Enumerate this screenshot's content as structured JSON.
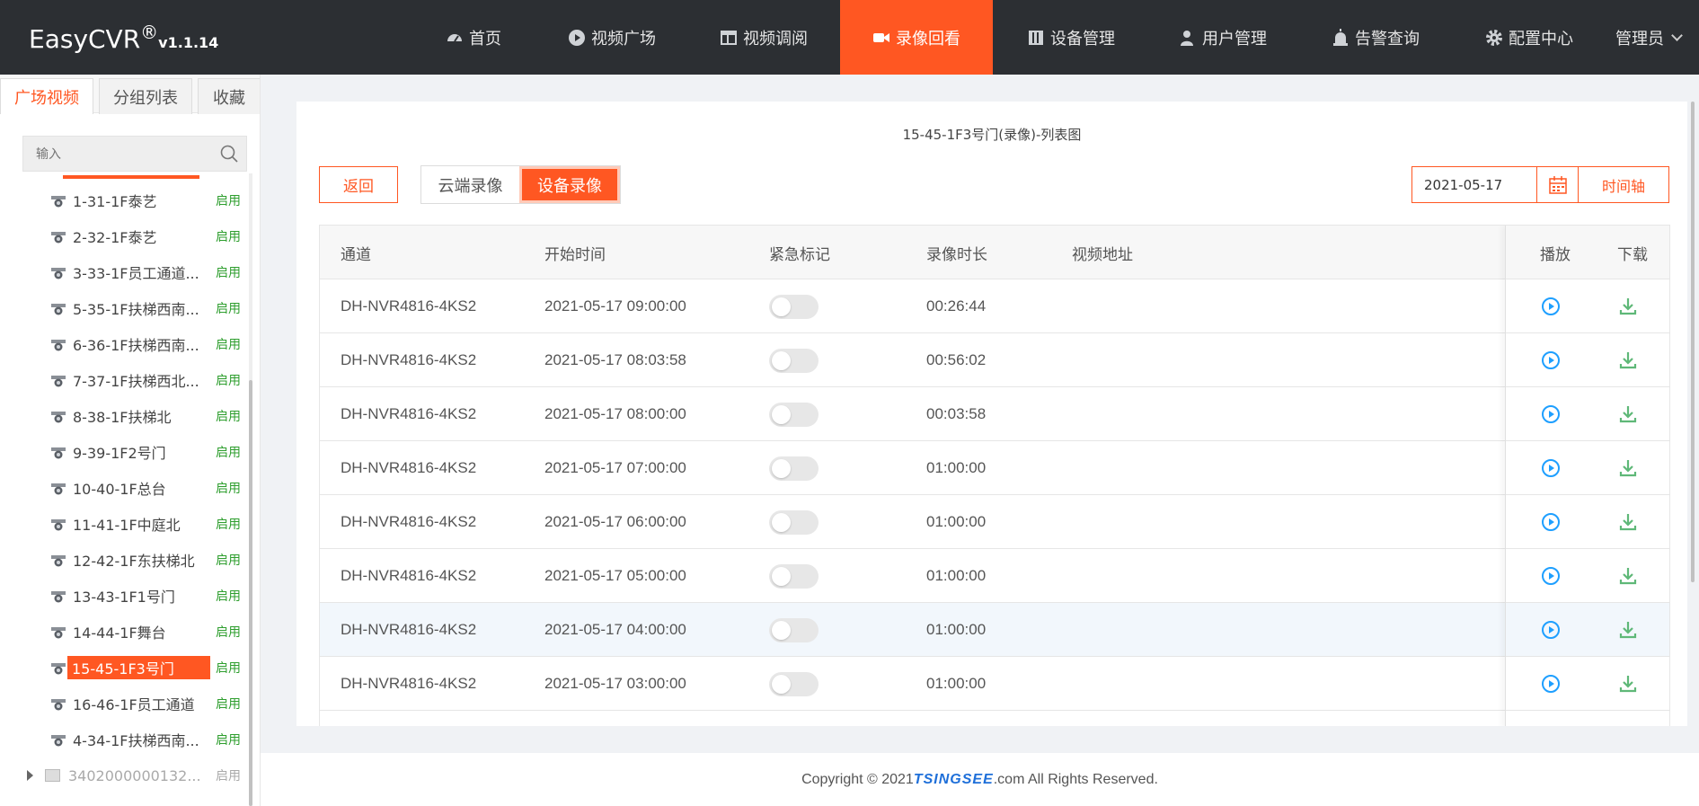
{
  "app": {
    "brand_name": "EasyCVR",
    "brand_reg": "®",
    "version": "v1.1.14"
  },
  "nav": {
    "items": [
      {
        "label": "首页",
        "icon": "dashboard-icon",
        "active": false
      },
      {
        "label": "视频广场",
        "icon": "play-circle-icon",
        "active": false
      },
      {
        "label": "视频调阅",
        "icon": "layout-icon",
        "active": false
      },
      {
        "label": "录像回看",
        "icon": "video-camera-icon",
        "active": true
      },
      {
        "label": "设备管理",
        "icon": "device-icon",
        "active": false
      },
      {
        "label": "用户管理",
        "icon": "user-icon",
        "active": false
      },
      {
        "label": "告警查询",
        "icon": "alarm-icon",
        "active": false
      },
      {
        "label": "配置中心",
        "icon": "gear-icon",
        "active": false
      }
    ],
    "user_label": "管理员"
  },
  "left": {
    "tabs": [
      {
        "label": "广场视频",
        "active": true
      },
      {
        "label": "分组列表",
        "active": false
      },
      {
        "label": "收藏",
        "active": false
      }
    ],
    "search_placeholder": "输入",
    "tree": [
      {
        "label": "1-31-1F泰艺",
        "status": "启用"
      },
      {
        "label": "2-32-1F泰艺",
        "status": "启用"
      },
      {
        "label": "3-33-1F员工通道...",
        "status": "启用"
      },
      {
        "label": "5-35-1F扶梯西南...",
        "status": "启用"
      },
      {
        "label": "6-36-1F扶梯西南...",
        "status": "启用"
      },
      {
        "label": "7-37-1F扶梯西北...",
        "status": "启用"
      },
      {
        "label": "8-38-1F扶梯北",
        "status": "启用"
      },
      {
        "label": "9-39-1F2号门",
        "status": "启用"
      },
      {
        "label": "10-40-1F总台",
        "status": "启用"
      },
      {
        "label": "11-41-1F中庭北",
        "status": "启用"
      },
      {
        "label": "12-42-1F东扶梯北",
        "status": "启用"
      },
      {
        "label": "13-43-1F1号门",
        "status": "启用"
      },
      {
        "label": "14-44-1F舞台",
        "status": "启用"
      },
      {
        "label": "15-45-1F3号门",
        "status": "启用",
        "selected": true
      },
      {
        "label": "16-46-1F员工通道",
        "status": "启用"
      },
      {
        "label": "4-34-1F扶梯西南...",
        "status": "启用"
      }
    ],
    "group_node": {
      "label": "3402000000132...",
      "status": "启用"
    }
  },
  "main": {
    "title": "15-45-1F3号门(录像)-列表图",
    "back_label": "返回",
    "source_tabs": [
      {
        "label": "云端录像",
        "active": false
      },
      {
        "label": "设备录像",
        "active": true
      }
    ],
    "date_value": "2021-05-17",
    "timeline_label": "时间轴",
    "columns": {
      "channel": "通道",
      "start_time": "开始时间",
      "urgent": "紧急标记",
      "duration": "录像时长",
      "url": "视频地址",
      "play": "播放",
      "download": "下载"
    },
    "rows": [
      {
        "channel": "DH-NVR4816-4KS2",
        "start": "2021-05-17 09:00:00",
        "urgent": false,
        "duration": "00:26:44",
        "url": ""
      },
      {
        "channel": "DH-NVR4816-4KS2",
        "start": "2021-05-17 08:03:58",
        "urgent": false,
        "duration": "00:56:02",
        "url": ""
      },
      {
        "channel": "DH-NVR4816-4KS2",
        "start": "2021-05-17 08:00:00",
        "urgent": false,
        "duration": "00:03:58",
        "url": ""
      },
      {
        "channel": "DH-NVR4816-4KS2",
        "start": "2021-05-17 07:00:00",
        "urgent": false,
        "duration": "01:00:00",
        "url": ""
      },
      {
        "channel": "DH-NVR4816-4KS2",
        "start": "2021-05-17 06:00:00",
        "urgent": false,
        "duration": "01:00:00",
        "url": ""
      },
      {
        "channel": "DH-NVR4816-4KS2",
        "start": "2021-05-17 05:00:00",
        "urgent": false,
        "duration": "01:00:00",
        "url": ""
      },
      {
        "channel": "DH-NVR4816-4KS2",
        "start": "2021-05-17 04:00:00",
        "urgent": false,
        "duration": "01:00:00",
        "url": "",
        "highlighted": true
      },
      {
        "channel": "DH-NVR4816-4KS2",
        "start": "2021-05-17 03:00:00",
        "urgent": false,
        "duration": "01:00:00",
        "url": ""
      }
    ]
  },
  "footer": {
    "prefix": "Copyright © 2021 ",
    "logo": "TSINGSEE",
    "suffix": ".com All Rights Reserved."
  },
  "colors": {
    "accent": "#ff5722",
    "topbar": "#2c2f33",
    "play": "#1e9fff",
    "download": "#5fb878",
    "status_on": "#2e9e2e"
  }
}
